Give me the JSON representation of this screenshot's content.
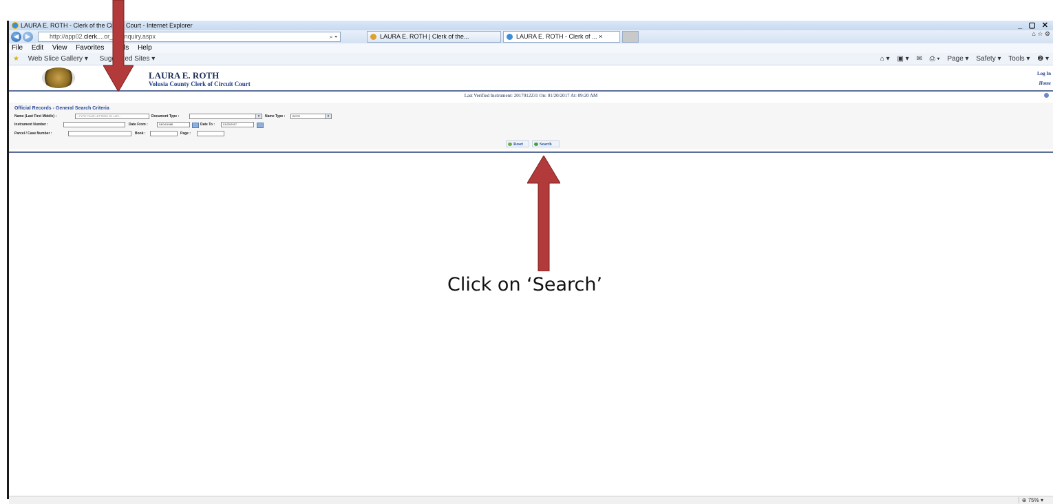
{
  "browser": {
    "window_title": "LAURA E. ROTH - Clerk of the Circuit Court - Internet Explorer",
    "window_controls": "_ ▢ ✕",
    "url_prefix": "http://app02.",
    "url_domain": "clerk.",
    "url_suffix": "...or_inq/inquiry.aspx",
    "tabs": [
      {
        "label": "LAURA E. ROTH | Clerk of the..."
      },
      {
        "label": "LAURA E. ROTH - Clerk of ... ×"
      }
    ],
    "menu": [
      "File",
      "Edit",
      "View",
      "Favorites",
      "Tools",
      "Help"
    ],
    "favorites": [
      "Web Slice Gallery ▾",
      "Suggested Sites ▾"
    ],
    "toolbar_right": [
      "Page ▾",
      "Safety ▾",
      "Tools ▾",
      "❷ ▾"
    ],
    "zoom": "75%"
  },
  "page": {
    "office_name": "LAURA E. ROTH",
    "office_sub": "Volusia County Clerk of Circuit Court",
    "login": "Log In",
    "home": "Home",
    "verified": "Last Verified Instrument: 2017012231 On: 01/20/2017 At: 09:20 AM"
  },
  "search_form": {
    "title": "Official Records - General Search Criteria",
    "name_label": "Name (Last First Middle) :",
    "name_placeholder": "--TYPE FOUR LETTERS TO LIST--",
    "doc_type_label": "Document Type :",
    "doc_type_value": "",
    "name_type_label": "Name Type :",
    "name_type_value": "BOTH",
    "instrument_label": "Instrument Number :",
    "date_from_label": "Date From :",
    "date_from_value": "04/04/1988",
    "date_to_label": "Date To :",
    "date_to_value": "01/20/2017",
    "parcel_label": "Parcel / Case Number :",
    "book_label": "Book :",
    "page_label": "Page :",
    "reset_label": "Reset",
    "search_label": "Search"
  },
  "annotation": {
    "instruction": "Click on ‘Search’",
    "arrow_color": "#b33a3a"
  }
}
